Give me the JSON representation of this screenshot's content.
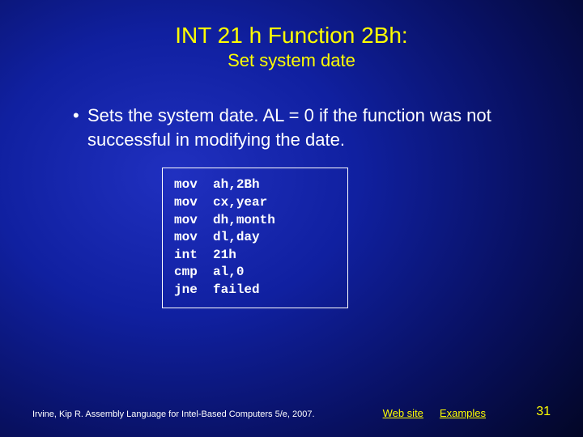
{
  "header": {
    "title": "INT 21 h Function 2Bh:",
    "subtitle": "Set system date"
  },
  "bullet": "Sets the system date. AL = 0 if the function was not successful in modifying the date.",
  "code": "mov  ah,2Bh\nmov  cx,year\nmov  dh,month\nmov  dl,day\nint  21h\ncmp  al,0\njne  failed",
  "footer": {
    "credit": "Irvine, Kip R. Assembly Language for Intel-Based Computers 5/e, 2007.",
    "link_web": "Web site",
    "link_examples": "Examples",
    "pagenum": "31"
  }
}
